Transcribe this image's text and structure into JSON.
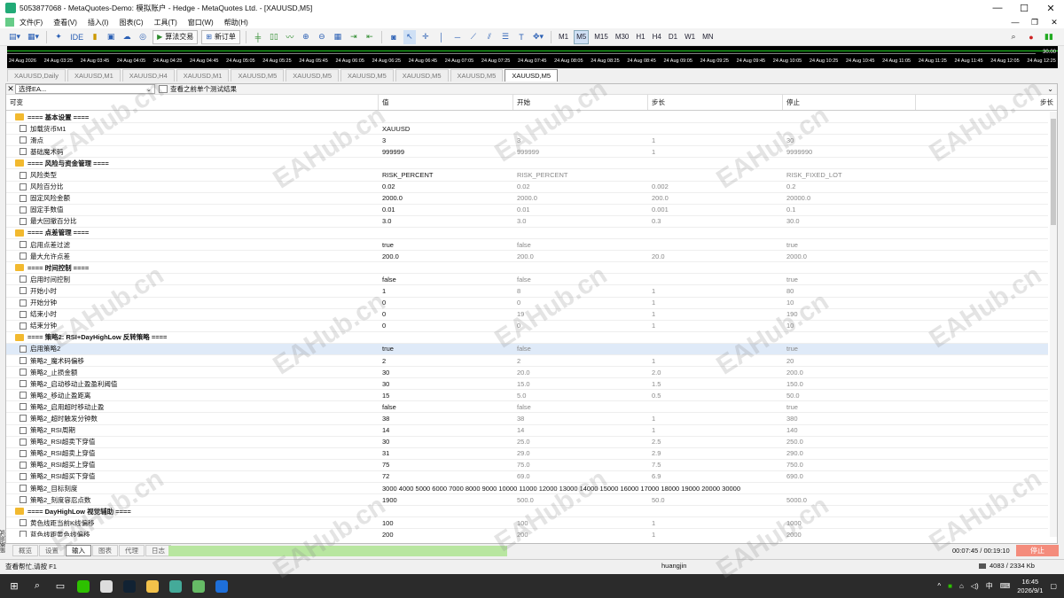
{
  "window": {
    "title": "5053877068 - MetaQuotes-Demo: 模拟账户 - Hedge - MetaQuotes Ltd. - [XAUUSD,M5]"
  },
  "menu": [
    "文件(F)",
    "查看(V)",
    "插入(I)",
    "图表(C)",
    "工具(T)",
    "窗口(W)",
    "帮助(H)"
  ],
  "toolbar": {
    "algo_label": "算法交易",
    "neworder_label": "新订单",
    "ide_label": "IDE",
    "timeframes": [
      "M1",
      "M5",
      "M15",
      "M30",
      "H1",
      "H4",
      "D1",
      "W1",
      "MN"
    ],
    "active_tf": "M5"
  },
  "chart": {
    "price": "30.00",
    "time_labels": [
      "24 Aug 2026",
      "24 Aug 03:25",
      "24 Aug 03:45",
      "24 Aug 04:05",
      "24 Aug 04:25",
      "24 Aug 04:45",
      "24 Aug 05:05",
      "24 Aug 05:25",
      "24 Aug 05:45",
      "24 Aug 06:05",
      "24 Aug 06:25",
      "24 Aug 06:45",
      "24 Aug 07:05",
      "24 Aug 07:25",
      "24 Aug 07:45",
      "24 Aug 08:05",
      "24 Aug 08:25",
      "24 Aug 08:45",
      "24 Aug 09:05",
      "24 Aug 09:25",
      "24 Aug 09:45",
      "24 Aug 10:05",
      "24 Aug 10:25",
      "24 Aug 10:45",
      "24 Aug 11:05",
      "24 Aug 11:25",
      "24 Aug 11:45",
      "24 Aug 12:05",
      "24 Aug 12:25"
    ]
  },
  "chart_tabs": [
    "XAUUSD,Daily",
    "XAUUSD,M1",
    "XAUUSD,H4",
    "XAUUSD,M1",
    "XAUUSD,M5",
    "XAUUSD,M5",
    "XAUUSD,M5",
    "XAUUSD,M5",
    "XAUUSD,M5",
    "XAUUSD,M5"
  ],
  "tester": {
    "ea_select": "选择EA...",
    "view_prev_label": "查看之前单个测试结果",
    "columns": [
      "可变",
      "值",
      "开始",
      "步长",
      "停止",
      "步长"
    ],
    "rows": [
      {
        "t": "g",
        "name": "==== 基本设置 ===="
      },
      {
        "t": "p",
        "name": "加载货币M1",
        "v": "XAUUSD",
        "s": "",
        "st": "",
        "e": ""
      },
      {
        "t": "p",
        "name": "滑点",
        "v": "3",
        "s": "3",
        "st": "1",
        "e": "30"
      },
      {
        "t": "p",
        "name": "基础魔术码",
        "v": "999999",
        "s": "999999",
        "st": "1",
        "e": "9999990"
      },
      {
        "t": "g",
        "name": "==== 风险与资金管理 ===="
      },
      {
        "t": "p",
        "name": "风险类型",
        "v": "RISK_PERCENT",
        "s": "RISK_PERCENT",
        "st": "",
        "e": "RISK_FIXED_LOT"
      },
      {
        "t": "p",
        "name": "风险百分比",
        "v": "0.02",
        "s": "0.02",
        "st": "0.002",
        "e": "0.2"
      },
      {
        "t": "p",
        "name": "固定风险金额",
        "v": "2000.0",
        "s": "2000.0",
        "st": "200.0",
        "e": "20000.0"
      },
      {
        "t": "p",
        "name": "固定手数值",
        "v": "0.01",
        "s": "0.01",
        "st": "0.001",
        "e": "0.1"
      },
      {
        "t": "p",
        "name": "最大回撤百分比",
        "v": "3.0",
        "s": "3.0",
        "st": "0.3",
        "e": "30.0"
      },
      {
        "t": "g",
        "name": "==== 点差管理 ===="
      },
      {
        "t": "p",
        "name": "启用点差过滤",
        "v": "true",
        "s": "false",
        "st": "",
        "e": "true"
      },
      {
        "t": "p",
        "name": "最大允许点差",
        "v": "200.0",
        "s": "200.0",
        "st": "20.0",
        "e": "2000.0"
      },
      {
        "t": "g",
        "name": "==== 时间控制 ===="
      },
      {
        "t": "p",
        "name": "启用时间控制",
        "v": "false",
        "s": "false",
        "st": "",
        "e": "true"
      },
      {
        "t": "p",
        "name": "开始小时",
        "v": "1",
        "s": "8",
        "st": "1",
        "e": "80"
      },
      {
        "t": "p",
        "name": "开始分钟",
        "v": "0",
        "s": "0",
        "st": "1",
        "e": "10"
      },
      {
        "t": "p",
        "name": "结束小时",
        "v": "0",
        "s": "19",
        "st": "1",
        "e": "190"
      },
      {
        "t": "p",
        "name": "结束分钟",
        "v": "0",
        "s": "0",
        "st": "1",
        "e": "10"
      },
      {
        "t": "g",
        "name": "==== 策略2: RSI+DayHighLow 反转策略 ===="
      },
      {
        "t": "p",
        "name": "启用策略2",
        "v": "true",
        "s": "false",
        "st": "",
        "e": "true",
        "hl": true
      },
      {
        "t": "p",
        "name": "策略2_魔术码偏移",
        "v": "2",
        "s": "2",
        "st": "1",
        "e": "20"
      },
      {
        "t": "p",
        "name": "策略2_止损金额",
        "v": "30",
        "s": "20.0",
        "st": "2.0",
        "e": "200.0"
      },
      {
        "t": "p",
        "name": "策略2_启动移动止盈盈利阈值",
        "v": "30",
        "s": "15.0",
        "st": "1.5",
        "e": "150.0"
      },
      {
        "t": "p",
        "name": "策略2_移动止盈距离",
        "v": "15",
        "s": "5.0",
        "st": "0.5",
        "e": "50.0"
      },
      {
        "t": "p",
        "name": "策略2_启用超时移动止盈",
        "v": "false",
        "s": "false",
        "st": "",
        "e": "true"
      },
      {
        "t": "p",
        "name": "策略2_超时触发分钟数",
        "v": "38",
        "s": "38",
        "st": "1",
        "e": "380"
      },
      {
        "t": "p",
        "name": "策略2_RSI周期",
        "v": "14",
        "s": "14",
        "st": "1",
        "e": "140"
      },
      {
        "t": "p",
        "name": "策略2_RSI超卖下穿值",
        "v": "30",
        "s": "25.0",
        "st": "2.5",
        "e": "250.0"
      },
      {
        "t": "p",
        "name": "策略2_RSI超卖上穿值",
        "v": "31",
        "s": "29.0",
        "st": "2.9",
        "e": "290.0"
      },
      {
        "t": "p",
        "name": "策略2_RSI超买上穿值",
        "v": "75",
        "s": "75.0",
        "st": "7.5",
        "e": "750.0"
      },
      {
        "t": "p",
        "name": "策略2_RSI超买下穿值",
        "v": "72",
        "s": "69.0",
        "st": "6.9",
        "e": "690.0"
      },
      {
        "t": "p",
        "name": "策略2_目标刻度",
        "v": "3000 4000 5000 6000 7000 8000 9000 10000 11000 12000 13000 14000 15000 16000 17000 18000 19000 20000 30000",
        "s": "",
        "st": "",
        "e": "",
        "wide": true
      },
      {
        "t": "p",
        "name": "策略2_刻度容忍点数",
        "v": "1900",
        "s": "500.0",
        "st": "50.0",
        "e": "5000.0"
      },
      {
        "t": "g",
        "name": "==== DayHighLow 视觉辅助 ===="
      },
      {
        "t": "p",
        "name": "黄色线距当前K线偏移",
        "v": "100",
        "s": "100",
        "st": "1",
        "e": "1000"
      },
      {
        "t": "p",
        "name": "蓝色线距黄色线偏移",
        "v": "200",
        "s": "200",
        "st": "1",
        "e": "2000"
      }
    ],
    "bottom_tabs": [
      "概览",
      "设置",
      "输入",
      "图表",
      "代理",
      "日志"
    ],
    "active_bottom_tab": "输入",
    "side_label": "策略测试",
    "progress": 0.35,
    "time_elapsed": "00:07:45 / 00:19:10",
    "stop_label": "停止"
  },
  "status": {
    "help": "查看帮忙,请按 F1",
    "user": "huangjin",
    "traffic": "4083 / 2334 Kb"
  },
  "taskbar": {
    "time": "16:45",
    "date": "2026/9/1",
    "ime": "中"
  },
  "watermark": "EAHub.cn"
}
